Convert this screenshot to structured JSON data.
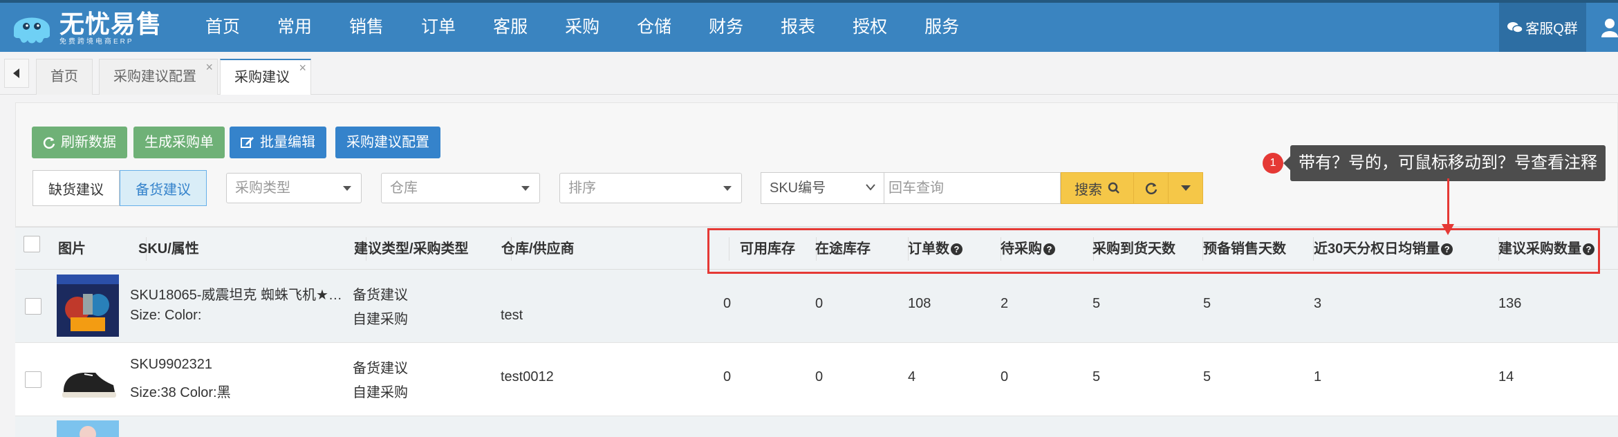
{
  "app": {
    "name": "无忧易售",
    "tagline": "免费跨境电商ERP"
  },
  "nav": {
    "items": [
      "首页",
      "常用",
      "销售",
      "订单",
      "客服",
      "采购",
      "仓储",
      "财务",
      "报表",
      "授权",
      "服务"
    ],
    "qq_label": "客服Q群"
  },
  "tabs": [
    {
      "label": "首页",
      "closable": false,
      "active": false
    },
    {
      "label": "采购建议配置",
      "closable": true,
      "active": false
    },
    {
      "label": "采购建议",
      "closable": true,
      "active": true
    }
  ],
  "toolbar": {
    "refresh": "刷新数据",
    "generate": "生成采购单",
    "batch_edit": "批量编辑",
    "config": "采购建议配置"
  },
  "filters": {
    "seg_shortage": "缺货建议",
    "seg_stock": "备货建议",
    "purchase_type": "采购类型",
    "warehouse": "仓库",
    "sort": "排序",
    "sku_field": "SKU编号",
    "search_placeholder": "回车查询",
    "search_btn": "搜索"
  },
  "annotation": {
    "number": "1",
    "text": "带有？号的，可鼠标移动到？号查看注释"
  },
  "table": {
    "headers": {
      "image": "图片",
      "sku": "SKU/属性",
      "type": "建议类型/采购类型",
      "warehouse": "仓库/供应商",
      "available": "可用库存",
      "in_transit": "在途库存",
      "orders": "订单数",
      "pending": "待采购",
      "arrival_days": "采购到货天数",
      "reserve_days": "预备销售天数",
      "avg_sales": "近30天分权日均销量",
      "suggest_qty": "建议采购数量"
    },
    "rows": [
      {
        "sku": "SKU18065-威震坦克 蜘蛛飞机★…",
        "attr": "Size: Color:",
        "suggest_type": "备货建议",
        "purchase_type": "自建采购",
        "warehouse": "test",
        "available": "0",
        "in_transit": "0",
        "orders": "108",
        "pending": "2",
        "arrival_days": "5",
        "reserve_days": "5",
        "avg_sales": "3",
        "suggest_qty": "136"
      },
      {
        "sku": "SKU9902321",
        "attr": "Size:38 Color:黑",
        "suggest_type": "备货建议",
        "purchase_type": "自建采购",
        "warehouse": "test0012",
        "available": "0",
        "in_transit": "0",
        "orders": "4",
        "pending": "0",
        "arrival_days": "5",
        "reserve_days": "5",
        "avg_sales": "1",
        "suggest_qty": "14"
      }
    ]
  }
}
